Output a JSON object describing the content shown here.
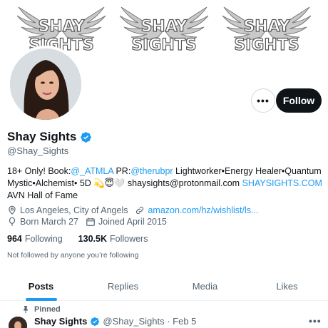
{
  "banner": {
    "logo_text": [
      "SHAY",
      "SIGHTS"
    ],
    "logo_count": 3
  },
  "actions": {
    "more_label": "•••",
    "follow_label": "Follow"
  },
  "profile": {
    "display_name": "Shay Sights",
    "handle": "@Shay_Sights",
    "bio": {
      "line1_prefix": "18+ Only! Book:",
      "line1_link1": "@_ATMLA",
      "line1_mid": " PR:",
      "line1_link2": "@therubpr",
      "line1_suffix": " Lightworker•Energy Healer•Quantum",
      "line2_prefix": "Mystic•Alchemist• 5D 💫😇🤍 shaysights@protonmail.com ",
      "line2_link": "SHAYSIGHTS.COM",
      "line3": "AVN Hall of Fame"
    },
    "location": "Los Angeles, City of Angels",
    "website": "amazon.com/hz/wishlist/ls...",
    "born": "Born March 27",
    "joined": "Joined April 2015",
    "following_count": "964",
    "following_label": "Following",
    "followers_count": "130.5K",
    "followers_label": "Followers",
    "not_followed": "Not followed by anyone you’re following"
  },
  "tabs": [
    {
      "label": "Posts",
      "active": true
    },
    {
      "label": "Replies",
      "active": false
    },
    {
      "label": "Media",
      "active": false
    },
    {
      "label": "Likes",
      "active": false
    }
  ],
  "pinned_post": {
    "pinned_label": "Pinned",
    "author": "Shay Sights",
    "handle_date": "@Shay_Sights · Feb 5",
    "more_label": "•••"
  },
  "colors": {
    "accent": "#1d9bf0",
    "text_primary": "#0f1419",
    "text_secondary": "#536471",
    "follow_button": "#0f1419"
  }
}
